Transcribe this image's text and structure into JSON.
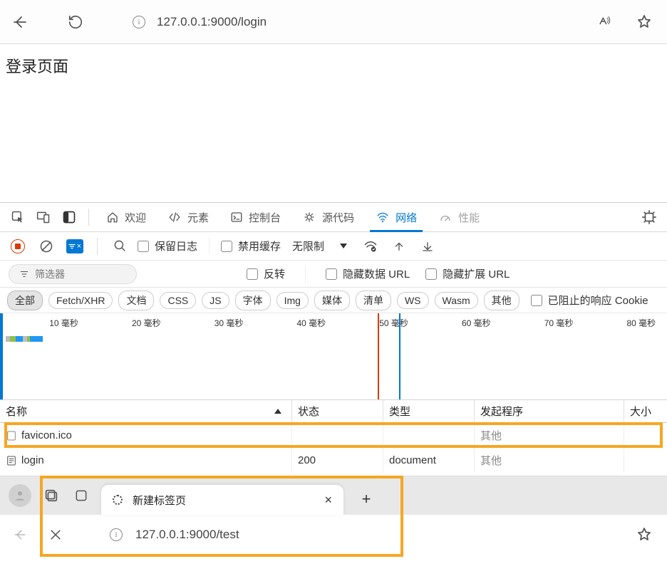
{
  "browser1": {
    "url": "127.0.0.1:9000/login"
  },
  "page": {
    "heading": "登录页面"
  },
  "devtools": {
    "tabs": {
      "welcome": "欢迎",
      "elements": "元素",
      "console": "控制台",
      "sources": "源代码",
      "network": "网络",
      "performance": "性能"
    },
    "toolbar2": {
      "preserve_log": "保留日志",
      "disable_cache": "禁用缓存",
      "throttle": "无限制"
    },
    "filter": {
      "placeholder": "筛选器",
      "invert": "反转",
      "hide_data_urls": "隐藏数据 URL",
      "hide_ext_urls": "隐藏扩展 URL"
    },
    "types": {
      "all": "全部",
      "fetch": "Fetch/XHR",
      "doc": "文档",
      "css": "CSS",
      "js": "JS",
      "font": "字体",
      "img": "Img",
      "media": "媒体",
      "manifest": "清单",
      "ws": "WS",
      "wasm": "Wasm",
      "other": "其他",
      "blocked_cookie": "已阻止的响应 Cookie"
    },
    "waterfall": {
      "ticks": [
        "10 毫秒",
        "20 毫秒",
        "30 毫秒",
        "40 毫秒",
        "50 毫秒",
        "60 毫秒",
        "70 毫秒",
        "80 毫秒"
      ]
    },
    "columns": {
      "name": "名称",
      "status": "状态",
      "type": "类型",
      "initiator": "发起程序",
      "size": "大小"
    },
    "rows": [
      {
        "name": "favicon.ico",
        "status": "",
        "type": "",
        "initiator": "其他",
        "size": ""
      },
      {
        "name": "login",
        "status": "200",
        "type": "document",
        "initiator": "其他",
        "size": ""
      }
    ]
  },
  "browser2": {
    "tab_title": "新建标签页",
    "url": "127.0.0.1:9000/test"
  }
}
